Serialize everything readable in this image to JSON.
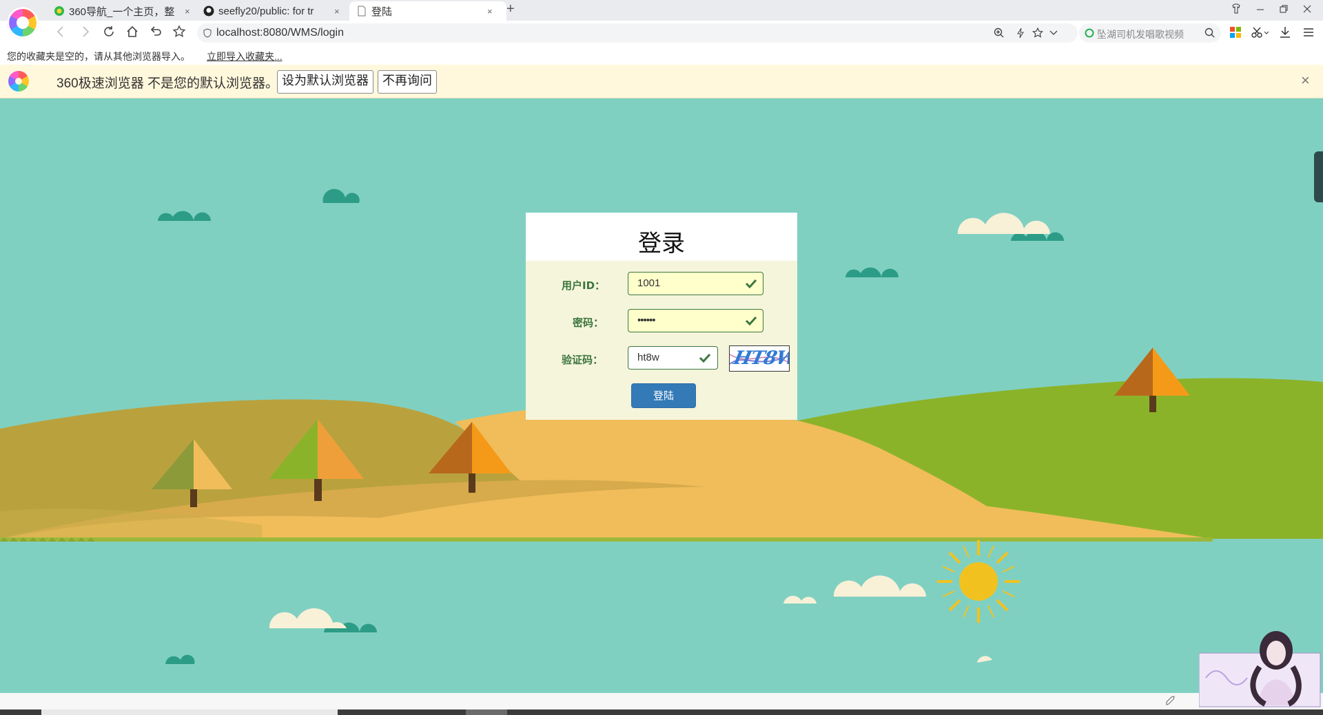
{
  "browser": {
    "tabs": [
      {
        "title": "360导航_一个主页，整",
        "close": "×"
      },
      {
        "title": "seefly20/public: for tr",
        "close": "×"
      },
      {
        "title": "登陆",
        "close": "×"
      }
    ],
    "new_tab": "+",
    "url": "localhost:8080/WMS/login",
    "search_placeholder": "坠湖司机发唱歌视频",
    "bookmark_notice": "您的收藏夹是空的，请从其他浏览器导入。",
    "bookmark_import_link": "立即导入收藏夹..."
  },
  "infobar": {
    "message": "360极速浏览器 不是您的默认浏览器。",
    "set_default_label": "设为默认浏览器",
    "dont_ask_label": "不再询问",
    "close": "×"
  },
  "login": {
    "title": "登录",
    "user_id_label": "用户ID：",
    "user_id_value": "1001",
    "password_label": "密码：",
    "password_value": "••••••",
    "captcha_label": "验证码：",
    "captcha_value": "ht8w",
    "captcha_image_text": "HT8W",
    "submit_label": "登陆"
  },
  "colors": {
    "sky": "#80d0c2",
    "form_success": "#3c763d",
    "input_bg": "#ffffcc",
    "button_primary": "#337ab7",
    "infobar_bg": "#fff8dc"
  },
  "icons": [
    "back-icon",
    "forward-icon",
    "reload-icon",
    "home-icon",
    "undo-icon",
    "star-icon",
    "shield-icon",
    "zoom-icon",
    "lightning-icon",
    "search-icon",
    "apps-icon",
    "scissors-icon",
    "download-icon",
    "menu-icon",
    "check-icon",
    "close-icon"
  ]
}
